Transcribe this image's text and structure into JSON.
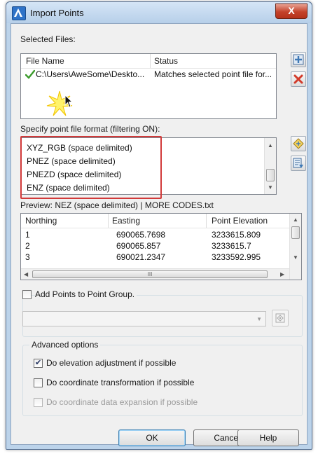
{
  "window": {
    "title": "Import Points",
    "close_glyph": "X"
  },
  "selected_files": {
    "label": "Selected Files:",
    "columns": [
      "File Name",
      "Status"
    ],
    "rows": [
      {
        "file_name": "C:\\Users\\AweSome\\Deskto...",
        "status": "Matches selected point file for..."
      }
    ]
  },
  "format": {
    "label": "Specify point file format (filtering ON):",
    "items": [
      "XYZ_RGB (space delimited)",
      "PNEZ (space delimited)",
      "PNEZD (space delimited)",
      "ENZ (space delimited)"
    ]
  },
  "preview": {
    "label": "Preview: NEZ (space delimited) | MORE CODES.txt",
    "columns": [
      "Northing",
      "Easting",
      "Point Elevation"
    ],
    "rows": [
      [
        "1",
        "690065.7698",
        "3233615.809"
      ],
      [
        "2",
        "690065.857",
        "3233615.7"
      ],
      [
        "3",
        "690021.2347",
        "3233592.995"
      ]
    ],
    "hscroll_grip": "III"
  },
  "point_group": {
    "label": "Add Points to Point Group.",
    "checked": false,
    "combo_value": ""
  },
  "advanced": {
    "title": "Advanced options",
    "options": [
      {
        "label": "Do elevation adjustment if possible",
        "checked": true,
        "enabled": true
      },
      {
        "label": "Do coordinate transformation if possible",
        "checked": false,
        "enabled": true
      },
      {
        "label": "Do coordinate data expansion if possible",
        "checked": false,
        "enabled": false
      }
    ]
  },
  "buttons": {
    "ok": "OK",
    "cancel": "Cancel",
    "help": "Help"
  },
  "colors": {
    "highlight": "#d23a3a",
    "title_bar": "#bcd3ea",
    "close_button": "#c4422a"
  },
  "icons": [
    "app-logo-icon",
    "add-file-icon",
    "remove-file-icon",
    "green-check-icon",
    "edit-format-icon",
    "manage-formats-icon",
    "pick-point-group-icon"
  ]
}
